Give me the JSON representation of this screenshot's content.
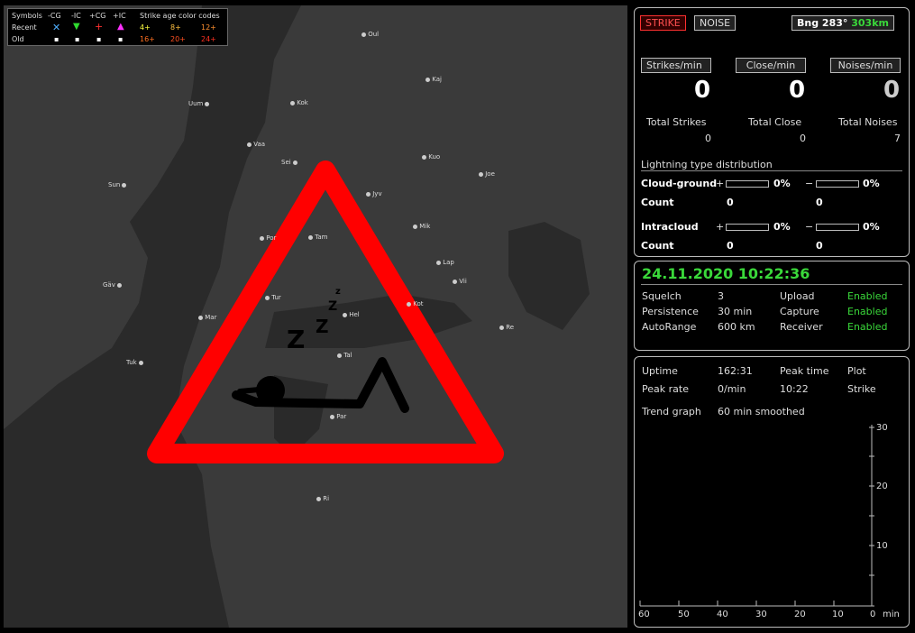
{
  "legend": {
    "symbols_label": "Symbols",
    "cols": [
      "-CG",
      "-IC",
      "+CG",
      "+IC"
    ],
    "recent_label": "Recent",
    "old_label": "Old",
    "age_title": "Strike age color codes",
    "age_recent": [
      "4+",
      "8+",
      "12+"
    ],
    "age_old": [
      "16+",
      "20+",
      "24+"
    ]
  },
  "map": {
    "cities": [
      "Oul",
      "Kaj",
      "Uum",
      "Kok",
      "Vaa",
      "Kuo",
      "Sei",
      "Joe",
      "Sun",
      "Jyv",
      "Mik",
      "Por",
      "Tam",
      "Lap",
      "Gäv",
      "Tur",
      "Vii",
      "Mar",
      "Hel",
      "Kot",
      "Re",
      "Tuk",
      "Tal",
      "Par",
      "Ri"
    ],
    "warning_text": "Z Z z"
  },
  "top_panel": {
    "strike_btn": "STRIKE",
    "noise_btn": "NOISE",
    "bearing_label": "Bng 283°",
    "bearing_dist": "303km",
    "strikes_min_btn": "Strikes/min",
    "close_min_btn": "Close/min",
    "noises_min_btn": "Noises/min",
    "strikes_min": "0",
    "close_min": "0",
    "noises_min": "0",
    "total_strikes_label": "Total Strikes",
    "total_close_label": "Total Close",
    "total_noises_label": "Total Noises",
    "total_strikes": "0",
    "total_close": "0",
    "total_noises": "7",
    "dist_title": "Lightning type distribution",
    "cg_label": "Cloud-ground",
    "ic_label": "Intracloud",
    "count_label": "Count",
    "plus": "+",
    "minus": "−",
    "cg_pos_pct": "0%",
    "cg_neg_pct": "0%",
    "ic_pos_pct": "0%",
    "ic_neg_pct": "0%",
    "cg_pos_count": "0",
    "cg_neg_count": "0",
    "ic_pos_count": "0",
    "ic_neg_count": "0"
  },
  "mid_panel": {
    "datetime": "24.11.2020 10:22:36",
    "squelch_label": "Squelch",
    "squelch": "3",
    "persistence_label": "Persistence",
    "persistence": "30 min",
    "autorange_label": "AutoRange",
    "autorange": "600 km",
    "upload_label": "Upload",
    "upload": "Enabled",
    "capture_label": "Capture",
    "capture": "Enabled",
    "receiver_label": "Receiver",
    "receiver": "Enabled"
  },
  "bottom_panel": {
    "uptime_label": "Uptime",
    "uptime": "162:31",
    "peak_time_label": "Peak time",
    "peak_time": "10:22",
    "plot_label": "Plot",
    "plot": "Strike",
    "peak_rate_label": "Peak rate",
    "peak_rate": "0/min",
    "trend_label": "Trend graph",
    "trend": "60 min smoothed",
    "x_ticks": [
      "60",
      "50",
      "40",
      "30",
      "20",
      "10",
      "0"
    ],
    "x_unit": "min",
    "y_ticks": [
      "30",
      "20",
      "10"
    ]
  },
  "colors": {
    "accent_green": "#3ad83a",
    "warning_red": "#ff0000",
    "strike_red": "#c00000"
  }
}
